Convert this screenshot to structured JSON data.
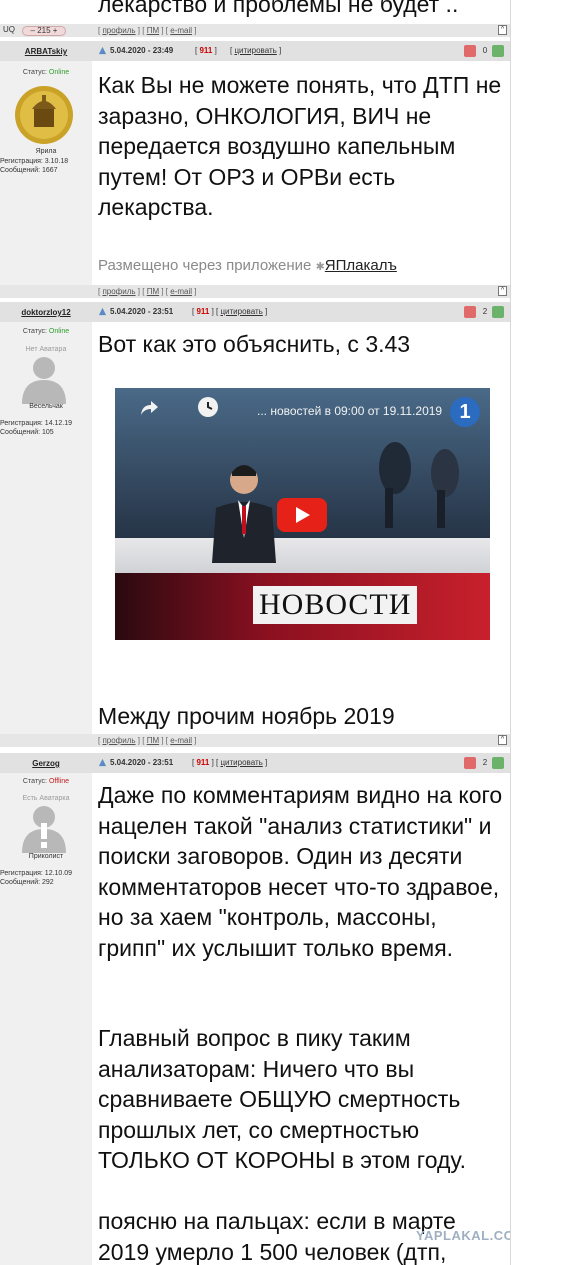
{
  "top_post": {
    "text_tail": "лекарство и проблемы не будет .."
  },
  "uq": {
    "label": "UQ",
    "value": "215",
    "minus": "–",
    "plus": "+"
  },
  "footer_links": {
    "profile": "профиль",
    "pm": "ПМ",
    "email": "e-mail",
    "up": "^"
  },
  "posts": [
    {
      "username": "ARBATskiy",
      "status_label": "Статус:",
      "status_value": "Online",
      "rank": "Ярила",
      "reg": "Регистрация: 3.10.18",
      "msgs": "Сообщений: 1667",
      "date": "5.04.2020 - 23:49",
      "num": "911",
      "quote": "цитировать",
      "rating": "0",
      "text": "Как Вы не можете понять, что ДТП не заразно, ОНКОЛОГИЯ, ВИЧ не передается воздушно капельным путем! От ОРЗ и ОРВи есть лекарства.",
      "app_note": "Размещено через приложение",
      "app_brand": "ЯПлакалъ",
      "app_star": "✱"
    },
    {
      "username": "doktorzloy12",
      "status_label": "Статус:",
      "status_value": "Online",
      "avatar_label": "Нет Аватара",
      "rank": "Весельчак",
      "reg": "Регистрация: 14.12.19",
      "msgs": "Сообщений: 105",
      "date": "5.04.2020 - 23:51",
      "num": "911",
      "quote": "цитировать",
      "rating": "2",
      "text": "Вот как это объяснить, с 3.43",
      "video_title": "... новостей в 09:00 от 19.11.2019",
      "video_banner": "НОВОСТИ",
      "video_logo": "1",
      "text_after": "Между прочим ноябрь 2019"
    },
    {
      "username": "Gerzog",
      "status_label": "Статус:",
      "status_value": "Offline",
      "avatar_label": "Есть Аватарка",
      "rank": "Приколист",
      "reg": "Регистрация: 12.10.09",
      "msgs": "Сообщений: 292",
      "date": "5.04.2020 - 23:51",
      "num": "911",
      "quote": "цитировать",
      "rating": "2",
      "para1": "Даже по комментариям видно на кого нацелен такой \"анализ статистики\" и поиски заговоров. Один из десяти комментаторов несет что-то здравое, но за хаем \"контроль, массоны, грипп\" их услышит только время.",
      "para2": "Главный вопрос в пику таким анализаторам: Ничего что вы сравниваете ОБЩУЮ смертность прошлых лет, со смертностью ТОЛЬКО ОТ КОРОНЫ в этом году.",
      "para3": "поясню на пальцах: если в марте 2019 умерло 1 500 человек (дтп,"
    }
  ],
  "watermark": "YAPLAKAL.COM"
}
